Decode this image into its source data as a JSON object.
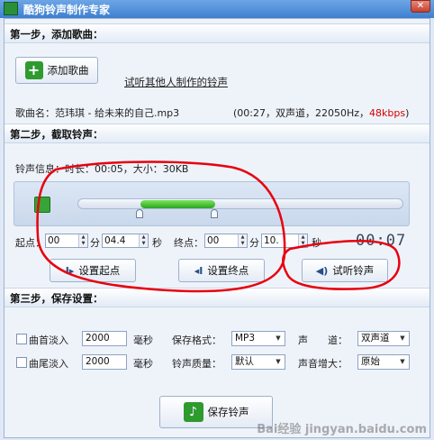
{
  "window": {
    "title": "酷狗铃声制作专家",
    "close_glyph": "✕"
  },
  "step1": {
    "header": "第一步，添加歌曲：",
    "add_button": "添加歌曲",
    "listen_link": "试听其他人制作的铃声",
    "song_label": "歌曲名：范玮琪 - 给未来的自己.mp3",
    "song_info": "(00:27，双声道，22050Hz，",
    "song_bitrate": "48kbps",
    "song_info_close": ")"
  },
  "step2": {
    "header": "第二步，截取铃声：",
    "ringtone_info": "铃声信息：时长：00:05，大小：30KB",
    "start_label": "起点：",
    "start_min": "00",
    "start_sec": "04.4",
    "end_label": "终点：",
    "end_min": "00",
    "end_sec": "10.",
    "unit_min": "分",
    "unit_sec": "秒",
    "lcd": "00:07",
    "set_start_button": "设置起点",
    "set_end_button": "设置终点",
    "preview_button": "试听铃声",
    "selection": {
      "start": 0.19,
      "end": 0.42
    }
  },
  "step3": {
    "header": "第三步，保存设置：",
    "fade_in_label": "曲首淡入",
    "fade_in_value": "2000",
    "fade_out_label": "曲尾淡入",
    "fade_out_value": "2000",
    "ms_unit": "毫秒",
    "format_label": "保存格式：",
    "format_value": "MP3",
    "quality_label": "铃声质量：",
    "quality_value": "默认",
    "channel_label": "声　　道：",
    "channel_value": "双声道",
    "boost_label": "声音增大：",
    "boost_value": "原始",
    "save_button": "保存铃声"
  },
  "watermark": "Bai经验 jingyan.baidu.com",
  "annotation_color": "#e8000f"
}
